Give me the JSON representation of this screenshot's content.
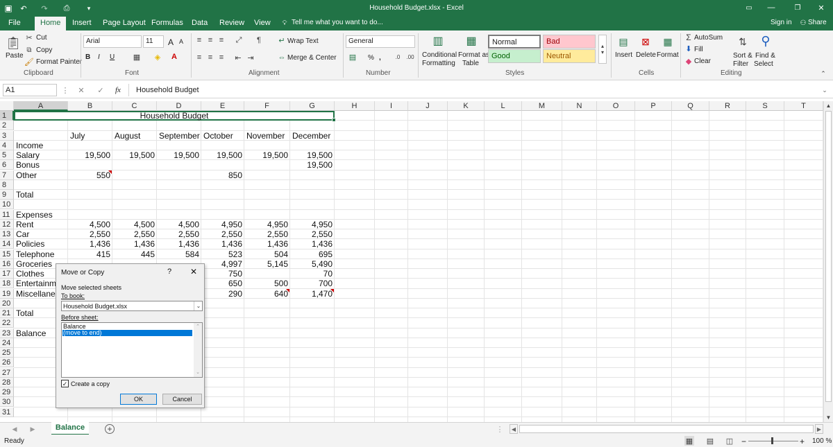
{
  "titlebar": {
    "title": "Household Budget.xlsx - Excel"
  },
  "ribbon_tabs": [
    "File",
    "Home",
    "Insert",
    "Page Layout",
    "Formulas",
    "Data",
    "Review",
    "View"
  ],
  "tell_me": "Tell me what you want to do...",
  "sign_in": "Sign in",
  "share": "Share",
  "clipboard": {
    "paste": "Paste",
    "cut": "Cut",
    "copy": "Copy",
    "format_painter": "Format Painter",
    "group": "Clipboard"
  },
  "font": {
    "name": "Arial",
    "size": "11",
    "bold": "B",
    "italic": "I",
    "underline": "U",
    "grow": "A",
    "shrink": "A",
    "group": "Font"
  },
  "alignment": {
    "wrap": "Wrap Text",
    "merge": "Merge & Center",
    "group": "Alignment"
  },
  "number": {
    "format": "General",
    "percent": "%",
    "comma": ",",
    "group": "Number"
  },
  "styles": {
    "conditional": "Conditional",
    "formatting": "Formatting",
    "format_as": "Format as",
    "table": "Table",
    "normal": "Normal",
    "bad": "Bad",
    "good": "Good",
    "neutral": "Neutral",
    "group": "Styles"
  },
  "cells": {
    "insert": "Insert",
    "delete": "Delete",
    "format": "Format",
    "group": "Cells"
  },
  "editing": {
    "autosum": "AutoSum",
    "fill": "Fill",
    "clear": "Clear",
    "sort": "Sort &",
    "filter": "Filter",
    "find": "Find &",
    "select": "Select",
    "group": "Editing"
  },
  "formula_bar": {
    "name_box": "A1",
    "fx": "fx",
    "content": "Household Budget"
  },
  "columns": [
    "A",
    "B",
    "C",
    "D",
    "E",
    "F",
    "G",
    "H",
    "I",
    "J",
    "K",
    "L",
    "M",
    "N",
    "O",
    "P",
    "Q",
    "R",
    "S",
    "T"
  ],
  "rows": [
    "1",
    "2",
    "3",
    "4",
    "5",
    "6",
    "7",
    "8",
    "9",
    "10",
    "11",
    "12",
    "13",
    "14",
    "15",
    "16",
    "17",
    "18",
    "19",
    "20",
    "21",
    "22",
    "23",
    "24",
    "25",
    "26",
    "27",
    "28",
    "29",
    "30",
    "31"
  ],
  "sheet": {
    "title": "Household Budget",
    "months": [
      "July",
      "August",
      "September",
      "October",
      "November",
      "December"
    ],
    "labels": {
      "r4": "Income",
      "r5": "Salary",
      "r6": "Bonus",
      "r7": "Other",
      "r9": "Total",
      "r11": "Expenses",
      "r12": "Rent",
      "r13": "Car",
      "r14": "Policies",
      "r15": "Telephone",
      "r16": "Groceries",
      "r17": "Clothes",
      "r18": "Entertainme",
      "r19": "Miscellaneo",
      "r21": "Total",
      "r23": "Balance"
    },
    "values": {
      "r5": [
        "19,500",
        "19,500",
        "19,500",
        "19,500",
        "19,500",
        "19,500"
      ],
      "r6": [
        "",
        "",
        "",
        "",
        "",
        "19,500"
      ],
      "r7": [
        "550",
        "",
        "",
        "850",
        "",
        ""
      ],
      "r12": [
        "4,500",
        "4,500",
        "4,500",
        "4,950",
        "4,950",
        "4,950"
      ],
      "r13": [
        "2,550",
        "2,550",
        "2,550",
        "2,550",
        "2,550",
        "2,550"
      ],
      "r14": [
        "1,436",
        "1,436",
        "1,436",
        "1,436",
        "1,436",
        "1,436"
      ],
      "r15": [
        "415",
        "445",
        "584",
        "523",
        "504",
        "695"
      ],
      "r16": [
        "",
        "",
        "",
        "4,997",
        "5,145",
        "5,490"
      ],
      "r17": [
        "",
        "",
        "",
        "750",
        "",
        "70"
      ],
      "r18": [
        "",
        "",
        "",
        "650",
        "500",
        "700"
      ],
      "r19": [
        "",
        "",
        "",
        "290",
        "640",
        "1,470"
      ]
    }
  },
  "dialog": {
    "title": "Move or Copy",
    "help": "?",
    "close": "✕",
    "move_label": "Move selected sheets",
    "to_book": "To book:",
    "book_value": "Household Budget.xlsx",
    "before_sheet": "Before sheet:",
    "list": [
      "Balance",
      "(move to end)"
    ],
    "create_copy": "Create a copy",
    "create_copy_checked": true,
    "ok": "OK",
    "cancel": "Cancel"
  },
  "sheet_tabs": {
    "active": "Balance",
    "add": "+"
  },
  "status": {
    "ready": "Ready",
    "zoom": "100 %"
  },
  "colors": {
    "excel_green": "#217346",
    "bad_bg": "#ffc7ce",
    "bad_fg": "#9c0006",
    "good_bg": "#c6efce",
    "good_fg": "#006100",
    "neutral_bg": "#ffeb9c",
    "neutral_fg": "#9c5700",
    "selection": "#0078d7"
  }
}
